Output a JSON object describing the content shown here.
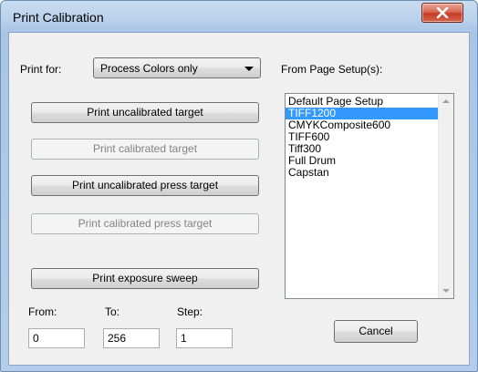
{
  "window": {
    "title": "Print Calibration",
    "close_icon": "close-icon"
  },
  "print_for": {
    "label": "Print for:",
    "selected": "Process Colors only"
  },
  "buttons": {
    "print_uncalibrated_target": "Print uncalibrated target",
    "print_calibrated_target": "Print calibrated target",
    "print_uncalibrated_press_target": "Print uncalibrated press target",
    "print_calibrated_press_target": "Print calibrated press target",
    "print_exposure_sweep": "Print exposure sweep",
    "cancel": "Cancel"
  },
  "page_setup": {
    "label": "From Page Setup(s):",
    "items": [
      "Default Page Setup",
      "TIFF1200",
      "CMYKComposite600",
      "TIFF600",
      "Tiff300",
      "Full Drum",
      "Capstan"
    ],
    "selected_index": 1
  },
  "sweep": {
    "from_label": "From:",
    "to_label": "To:",
    "step_label": "Step:",
    "from_value": "0",
    "to_value": "256",
    "step_value": "1"
  },
  "colors": {
    "selection": "#3399ff",
    "disabled_text": "#838383"
  }
}
